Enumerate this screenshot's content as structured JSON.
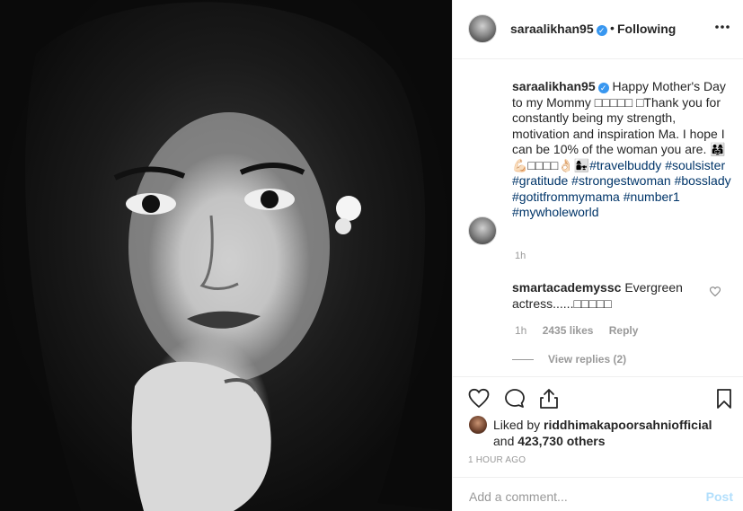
{
  "header": {
    "username": "saraalikhan95",
    "separator": "•",
    "follow_status": "Following"
  },
  "caption": {
    "username": "saraalikhan95",
    "text": "Happy Mother's Day to my Mommy □□□□□ □Thank you for constantly being my strength, motivation and inspiration Ma. I hope I can be 10% of the woman you are.",
    "emoji_line": "👨‍👩‍👧💪🏻□□□□👌🏻👩‍👧",
    "hashtags": [
      "#travelbuddy",
      "#soulsister",
      "#gratitude",
      "#strongestwoman",
      "#bosslady",
      "#gotitfrommymama",
      "#number1",
      "#mywholeworld"
    ],
    "time": "1h"
  },
  "comment": {
    "username": "smartacademyssc",
    "text": "Evergreen actress......□□□□□",
    "time": "1h",
    "likes": "2435 likes",
    "reply_label": "Reply",
    "view_replies": "View replies (2)"
  },
  "likes": {
    "prefix": "Liked by",
    "user": "riddhimakapoorsahniofficial",
    "and": "and",
    "others": "423,730 others"
  },
  "time_ago": "1 HOUR AGO",
  "add_comment": {
    "placeholder": "Add a comment...",
    "post_label": "Post"
  },
  "icons": {
    "more": "more-icon",
    "verified": "verified-icon",
    "heart": "heart-icon",
    "comment": "comment-icon",
    "share": "share-icon",
    "save": "bookmark-icon"
  },
  "colors": {
    "hashtag": "#003569",
    "verified": "#3897f0",
    "post_disabled": "#b2dffc",
    "meta_gray": "#999999"
  }
}
